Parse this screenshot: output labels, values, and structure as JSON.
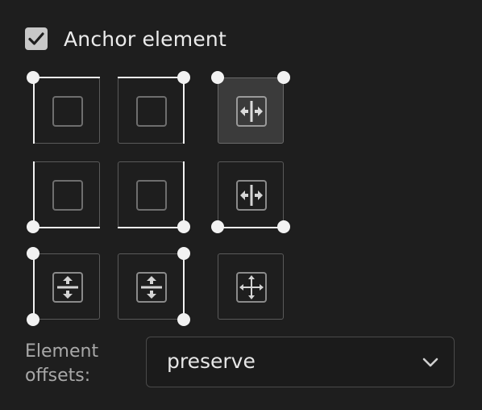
{
  "anchor": {
    "label": "Anchor element",
    "checked": true
  },
  "grid": {
    "selected_cell": "top-right",
    "cells": [
      {
        "name": "top-left",
        "icon": "square-icon"
      },
      {
        "name": "top-center",
        "icon": "square-icon"
      },
      {
        "name": "top-right",
        "icon": "horizontal-stretch-icon"
      },
      {
        "name": "middle-left",
        "icon": "square-icon"
      },
      {
        "name": "middle-center",
        "icon": "square-icon"
      },
      {
        "name": "middle-right",
        "icon": "horizontal-stretch-icon"
      },
      {
        "name": "bottom-left",
        "icon": "vertical-stretch-icon"
      },
      {
        "name": "bottom-center",
        "icon": "vertical-stretch-icon"
      },
      {
        "name": "bottom-right",
        "icon": "move-all-icon"
      }
    ]
  },
  "offsets": {
    "label": "Element offsets:",
    "value": "preserve"
  },
  "colors": {
    "background": "#1e1e1e",
    "cell_border": "#5a5a5a",
    "selected_cell": "#3b3b3b",
    "anchor_highlight": "#f2f2f2",
    "checkbox": "#c8c8c8"
  }
}
